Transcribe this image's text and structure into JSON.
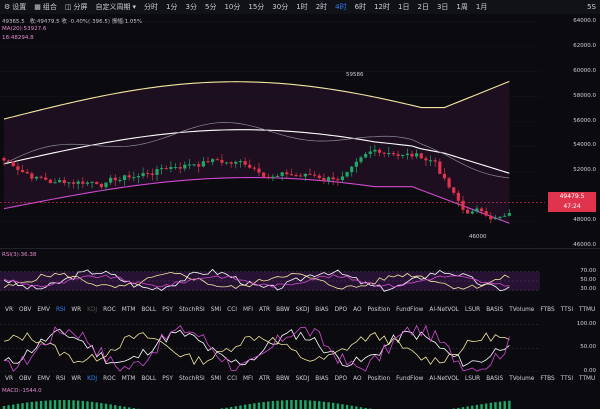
{
  "toolbar": {
    "items": [
      {
        "label": "设置",
        "icon": "gear-icon"
      },
      {
        "label": "组合",
        "icon": "layers-icon"
      },
      {
        "label": "分屏",
        "icon": "split-screen-icon"
      },
      {
        "label": "自定义周期",
        "icon": "chevron-down-icon"
      }
    ],
    "intervals": [
      "分时",
      "1分",
      "3分",
      "5分",
      "10分",
      "15分",
      "30分",
      "1时",
      "2时",
      "4时",
      "6时",
      "12时",
      "1日",
      "2日",
      "3日",
      "1周",
      "1月"
    ],
    "active_interval": "4时",
    "right_label": "5S"
  },
  "info": {
    "ohlc": "收:49479.5   收 -0.40%(-396.5)  振幅:1.05%",
    "ohlc_prefix": "49365.5",
    "ma_line": "MA(20):53927.6",
    "boll_line": "18:48294.8"
  },
  "price_axis": {
    "ticks": [
      "64000.0",
      "62000.0",
      "60000.0",
      "58000.0",
      "56000.0",
      "54000.0",
      "52000.0",
      "50000.0",
      "48000.0",
      "46000.0"
    ],
    "last_price": "49479.5",
    "countdown": "47:24",
    "last_price_color": "#e0334d"
  },
  "annotations": {
    "high": "59586",
    "low": "46000"
  },
  "rsi": {
    "label": "RSI(3):36.38",
    "ticks": [
      "70.00",
      "50.00",
      "30.00"
    ]
  },
  "tabs1": [
    "VR",
    "OBV",
    "EMV",
    "RSI",
    "WR",
    "KDJ",
    "ROC",
    "MTM",
    "BOLL",
    "PSY",
    "StochRSI",
    "SMI",
    "CCI",
    "MFI",
    "ATR",
    "BBW",
    "SKDJ",
    "BIAS",
    "DPO",
    "AO",
    "Position",
    "FundFlow",
    "AI-NetVOL",
    "LSUR",
    "BASIS",
    "TVolume",
    "FTBS",
    "TTSI",
    "TTMU"
  ],
  "tabs1_active": "RSI",
  "oscillator": {
    "ticks": [
      "100.00",
      "50.00",
      "0.00"
    ]
  },
  "tabs2": [
    "VR",
    "OBV",
    "EMV",
    "RSI",
    "WR",
    "KDJ",
    "ROC",
    "MTM",
    "BOLL",
    "PSY",
    "StochRSI",
    "SMI",
    "CCI",
    "MFI",
    "ATR",
    "BBW",
    "SKDJ",
    "BIAS",
    "DPO",
    "AO",
    "Position",
    "FundFlow",
    "AI-NetVOL",
    "LSUR",
    "BASIS",
    "TVolume",
    "FTBS",
    "TTSI",
    "TTMU"
  ],
  "tabs2_active": "KDJ",
  "macd": {
    "label": "MACD:-1544.0"
  },
  "colors": {
    "up": "#1fa86a",
    "down": "#e0334d",
    "accent": "#2f7cf6",
    "boll_upper": "#f2e6a0",
    "boll_lower": "#d04ad0",
    "ma": "#ffffff"
  }
}
